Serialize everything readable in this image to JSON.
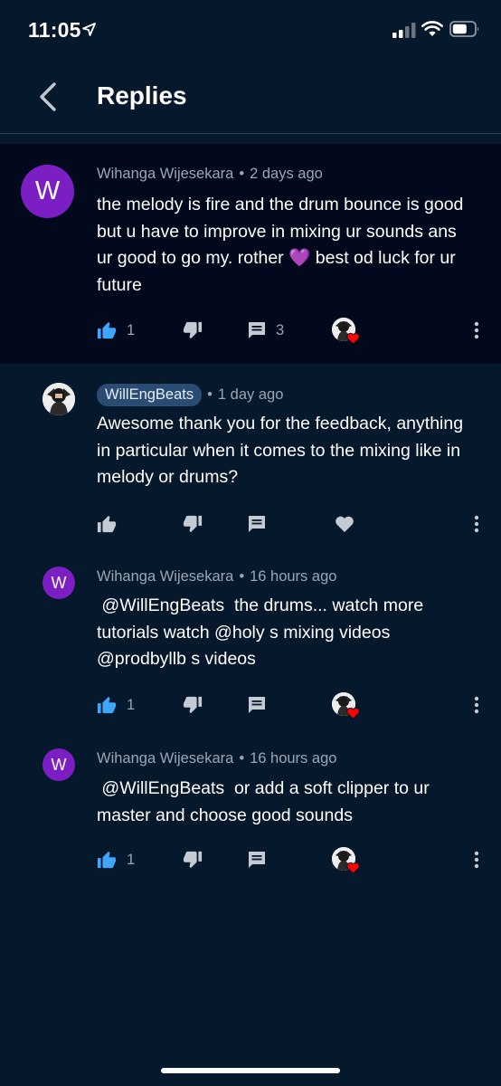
{
  "status_bar": {
    "time": "11:05"
  },
  "header": {
    "title": "Replies"
  },
  "colors": {
    "background": "#06182b",
    "parent_highlight": "#02091d",
    "avatar_purple": "#7b1fc4",
    "like_blue": "#3ea6ff",
    "creator_badge": "#2a4b72",
    "heart_red": "#ff0000"
  },
  "parent_comment": {
    "avatar_letter": "W",
    "author": "Wihanga Wijesekara",
    "time": "2 days ago",
    "text": "the melody is fire and the drum bounce is good but u have to improve in mixing ur sounds ans ur good to go my. rother 💜 best od luck for ur future",
    "likes": "1",
    "replies": "3",
    "liked": true,
    "creator_hearted": true
  },
  "replies": [
    {
      "author": "WillEngBeats",
      "is_creator": true,
      "time": "1 day ago",
      "text": "Awesome thank you for the feedback, anything in particular when it comes to the mixing like in melody or drums?",
      "liked": false
    },
    {
      "avatar_letter": "W",
      "author": "Wihanga Wijesekara",
      "time": "16 hours ago",
      "text": " @WillEngBeats  the drums... watch more tutorials watch @holy s mixing videos @prodbyllb s videos",
      "likes": "1",
      "liked": true,
      "creator_hearted": true
    },
    {
      "avatar_letter": "W",
      "author": "Wihanga Wijesekara",
      "time": "16 hours ago",
      "text": " @WillEngBeats  or add a soft clipper to ur master and choose good sounds",
      "likes": "1",
      "liked": true,
      "creator_hearted": true
    }
  ]
}
